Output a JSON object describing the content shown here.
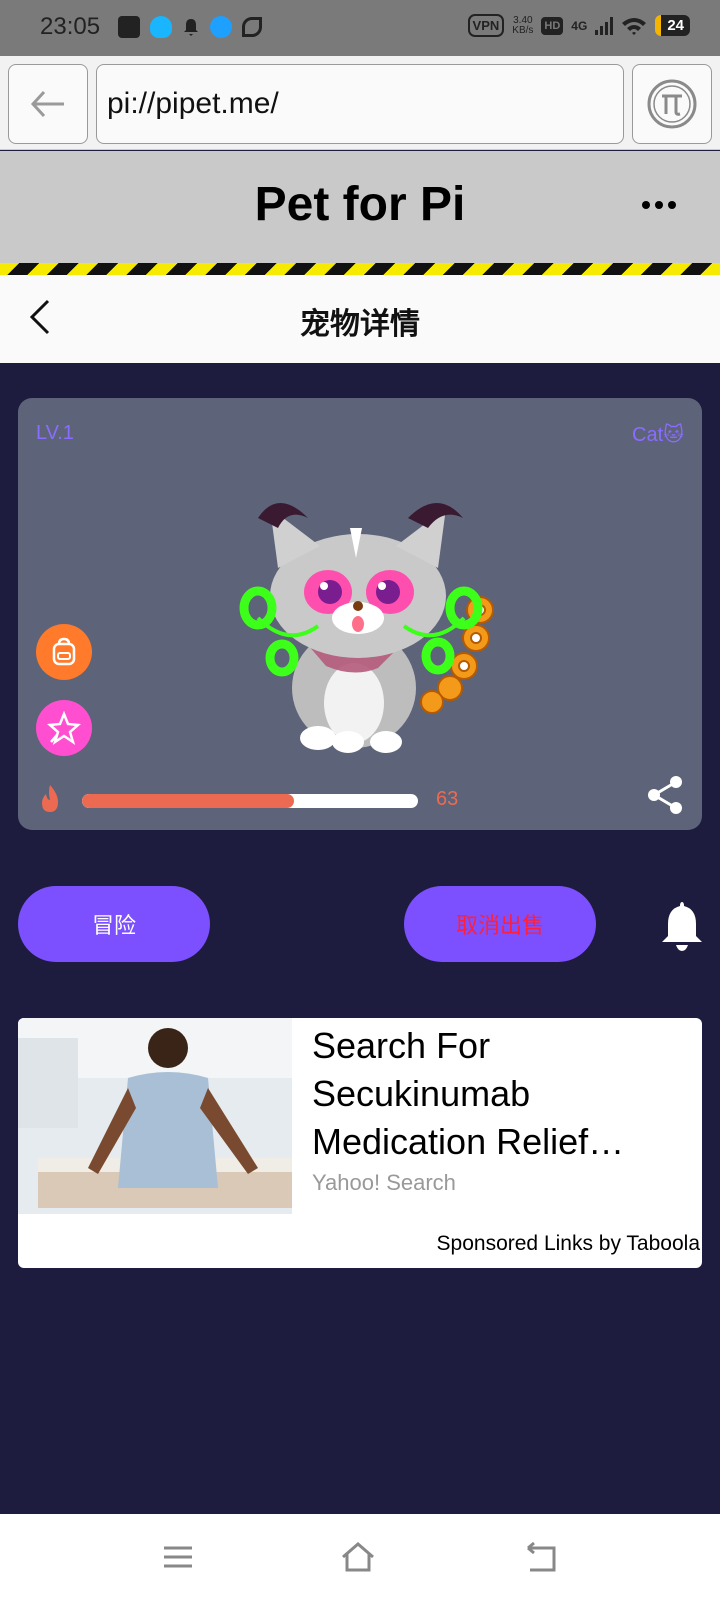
{
  "status_bar": {
    "time": "23:05",
    "vpn": "VPN",
    "speed_value": "3.40",
    "speed_unit": "KB/s",
    "hd": "HD",
    "network": "4G",
    "battery": "24"
  },
  "browser": {
    "url": "pi://pipet.me/"
  },
  "app": {
    "title": "Pet for Pi"
  },
  "page": {
    "title": "宠物详情"
  },
  "pet": {
    "level": "LV.1",
    "species": "Cat🐱",
    "energy_value": "63",
    "energy_fraction": 0.63
  },
  "actions": {
    "adventure_label": "冒险",
    "cancel_sale_label": "取消出售"
  },
  "ad": {
    "title": "Search For Secukinumab Medication Relief…",
    "source": "Yahoo! Search",
    "sponsor": "Sponsored Links by Taboola"
  },
  "colors": {
    "background": "#1d1c3e",
    "card": "#5d6378",
    "accent_purple": "#7c50ff",
    "energy": "#ec6a52",
    "cancel_text": "#ff1f3a"
  },
  "icons": [
    "back-arrow-icon",
    "pi-logo-icon",
    "more-icon",
    "chevron-left-icon",
    "backpack-icon",
    "magic-star-icon",
    "fire-icon",
    "share-icon",
    "bell-icon",
    "menu-icon",
    "home-icon",
    "return-icon"
  ]
}
